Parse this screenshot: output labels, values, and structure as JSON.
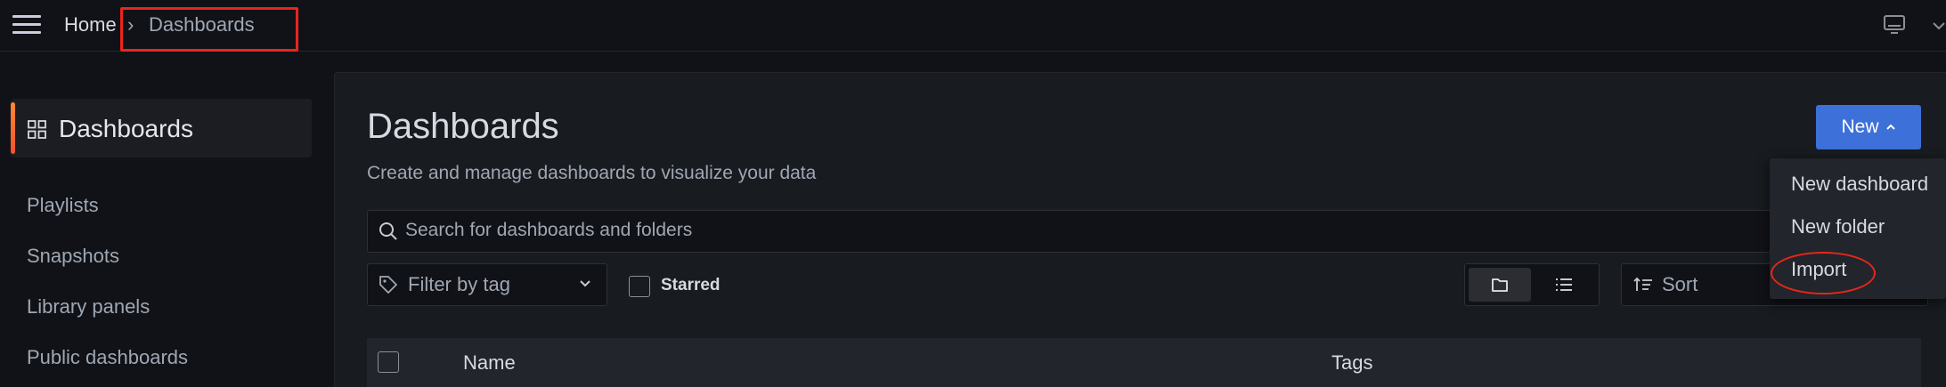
{
  "breadcrumb": {
    "home": "Home",
    "separator": "›",
    "current": "Dashboards"
  },
  "top_icons": [
    "hamburger-menu-icon",
    "monitor-icon",
    "chevron-down-icon"
  ],
  "sidebar": {
    "active": {
      "label": "Dashboards",
      "icon": "grid-icon"
    },
    "items": [
      {
        "label": "Playlists"
      },
      {
        "label": "Snapshots"
      },
      {
        "label": "Library panels"
      },
      {
        "label": "Public dashboards"
      }
    ]
  },
  "page": {
    "title": "Dashboards",
    "subtitle": "Create and manage dashboards to visualize your data"
  },
  "new_button": {
    "label": "New"
  },
  "new_menu": {
    "items": [
      {
        "label": "New dashboard"
      },
      {
        "label": "New folder"
      },
      {
        "label": "Import"
      }
    ]
  },
  "search": {
    "placeholder": "Search for dashboards and folders"
  },
  "filters": {
    "tag_label": "Filter by tag",
    "starred_label": "Starred",
    "sort_label": "Sort"
  },
  "table": {
    "columns": [
      "Name",
      "Tags"
    ]
  },
  "colors": {
    "accent": "#3d71d9",
    "active_bar": "#f5522b",
    "highlight": "#e8261b"
  }
}
